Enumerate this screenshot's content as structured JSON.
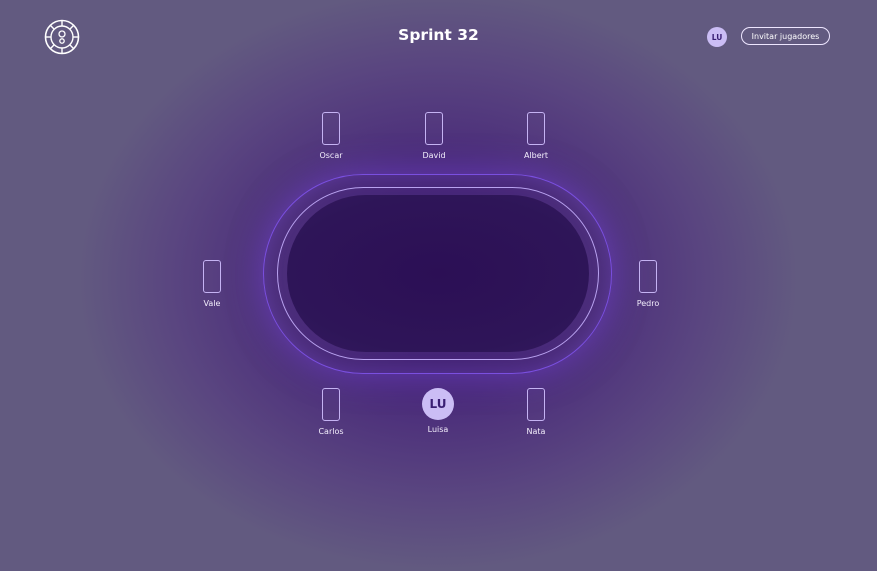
{
  "header": {
    "title": "Sprint 32",
    "user_initials": "LU",
    "invite_label": "Invitar jugadores",
    "logo_icon": "poker-chip-icon"
  },
  "table": {
    "top_seats": [
      {
        "name": "Oscar"
      },
      {
        "name": "David"
      },
      {
        "name": "Albert"
      }
    ],
    "left_seat": {
      "name": "Vale"
    },
    "right_seat": {
      "name": "Pedro"
    },
    "bottom_seats": [
      {
        "name": "Carlos"
      },
      {
        "name": "Luisa",
        "initials": "LU"
      },
      {
        "name": "Nata"
      }
    ]
  },
  "colors": {
    "accent": "#7a4fe0",
    "avatar_bg": "#cbbdf5",
    "table_felt": "#2c0f55"
  }
}
